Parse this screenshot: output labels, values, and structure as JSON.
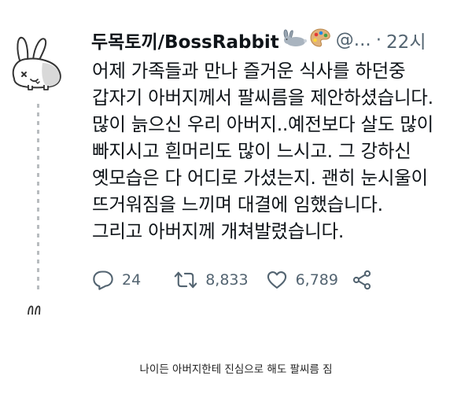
{
  "tweet": {
    "display_name": "두목토끼/BossRabbit",
    "handle": "@...",
    "time": "22시",
    "lines": [
      "어제 가족들과 만나 즐거운 식사를 하던중",
      "갑자기 아버지께서 팔씨름을 제안하셨습니다.",
      "많이 늙으신 우리 아버지..예전보다 살도 많이",
      "빠지시고 흰머리도 많이 느시고. 그 강하신",
      "옛모습은 다 어디로 가셨는지. 괜히 눈시울이",
      "뜨거워짐을 느끼며 대결에 임했습니다.",
      "그리고 아버지께 개쳐발렸습니다."
    ],
    "icons": {
      "name_emoji_1": "rabbit-emoji-icon",
      "name_emoji_2": "palette-emoji-icon",
      "reply": "reply-icon",
      "retweet": "retweet-icon",
      "like": "heart-icon",
      "share": "share-icon"
    },
    "counts": {
      "replies": "24",
      "retweets": "8,833",
      "likes": "6,789"
    },
    "colors": {
      "text": "#0f1419",
      "secondary": "#536471"
    }
  },
  "caption": "나이든 아버지한테 진심으로 해도 팔씨름 짐"
}
